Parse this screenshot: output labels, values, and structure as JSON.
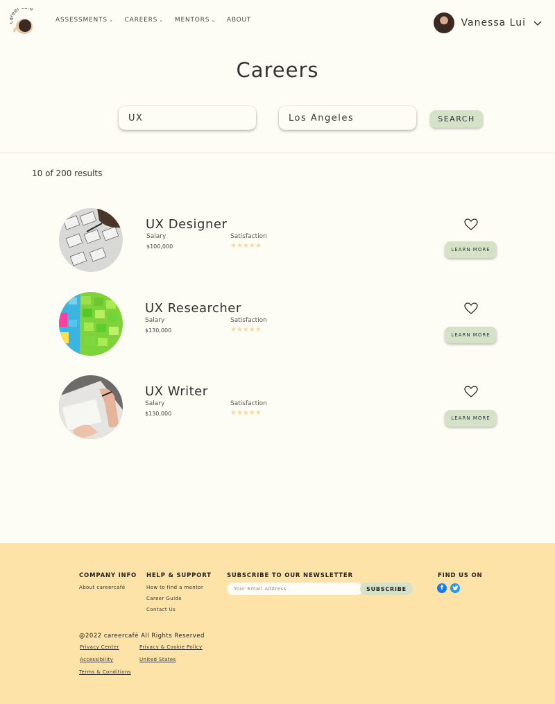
{
  "header": {
    "logo_text": "career café",
    "nav": [
      {
        "label": "ASSESSMENTS",
        "has_dropdown": true
      },
      {
        "label": "CAREERS",
        "has_dropdown": true
      },
      {
        "label": "MENTORS",
        "has_dropdown": true
      },
      {
        "label": "ABOUT",
        "has_dropdown": false
      }
    ],
    "user_name": "Vanessa Lui",
    "chevron_icon": "chevron-down-icon"
  },
  "page_title": "Careers",
  "search": {
    "job_value": "UX",
    "location_value": "Los Angeles",
    "button_label": "SEARCH"
  },
  "results_count": "10 of 200 results",
  "careers": [
    {
      "title": "UX Designer",
      "salary_label": "Salary",
      "salary": "$100,000",
      "satisfaction_label": "Satisfaction",
      "rating": 5,
      "button": "LEARN MORE"
    },
    {
      "title": "UX Researcher",
      "salary_label": "Salary",
      "salary": "$130,000",
      "satisfaction_label": "Satisfaction",
      "rating": 5,
      "button": "LEARN MORE"
    },
    {
      "title": "UX Writer",
      "salary_label": "Salary",
      "salary": "$130,000",
      "satisfaction_label": "Satisfaction",
      "rating": 5,
      "button": "LEARN MORE"
    }
  ],
  "footer": {
    "company_info": {
      "heading": "COMPANY INFO",
      "links": [
        "About careercafé"
      ]
    },
    "help_support": {
      "heading": "HELP & SUPPORT",
      "links": [
        "How to find a mentor",
        "Career Guide",
        "Contact Us"
      ]
    },
    "newsletter": {
      "heading": "SUBSCRIBE TO OUR NEWSLETTER",
      "placeholder": "Your Email Address",
      "button": "SUBSCRIBE"
    },
    "find_us": {
      "heading": "FIND US ON",
      "icons": [
        "facebook-icon",
        "twitter-icon"
      ]
    },
    "copyright": "@2022 careercafé All Rights Reserved",
    "legal_links": [
      "Privacy Center",
      "Privacy & Cookie Policy",
      "Accessibility",
      "United States",
      "Terms & Conditions"
    ]
  },
  "colors": {
    "background": "#fefdf5",
    "button_green": "#d5e2c8",
    "footer_yellow": "#fde3a7",
    "star": "#f6d99a"
  }
}
